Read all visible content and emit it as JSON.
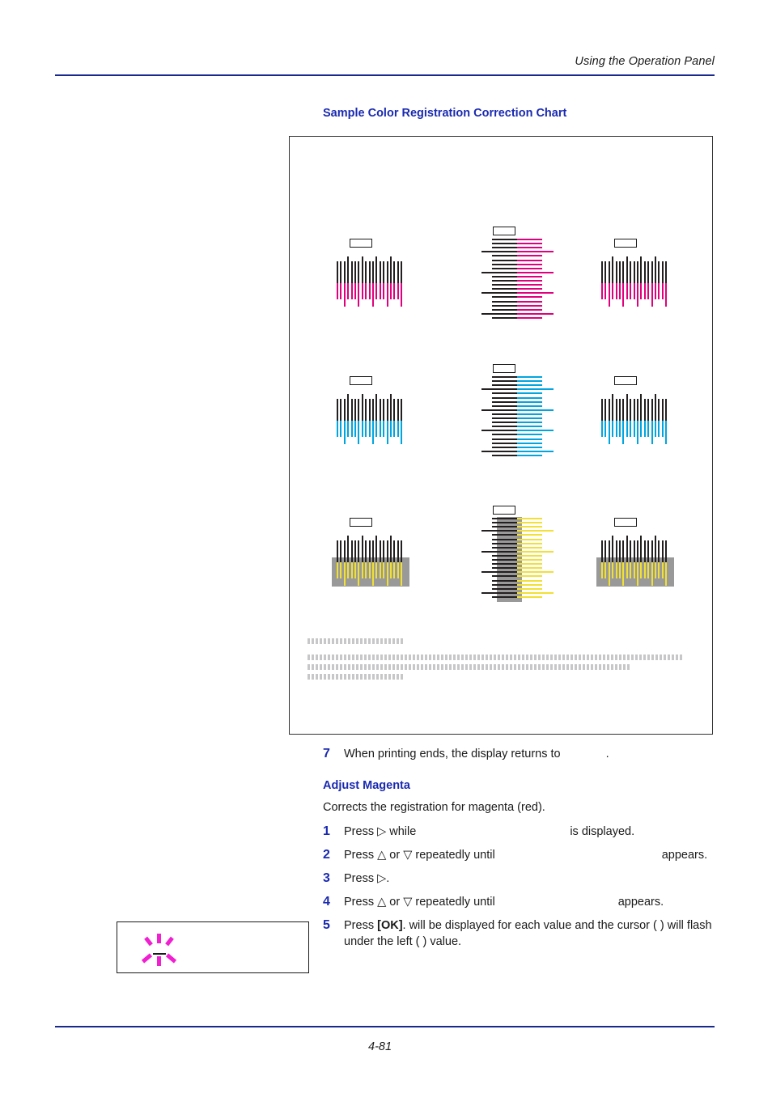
{
  "header": {
    "running_title": "Using the Operation Panel"
  },
  "section": {
    "heading": "Sample Color Registration Correction Chart"
  },
  "chart": {
    "rows": [
      {
        "name": "magenta",
        "color": "#e0007d",
        "label": "Magenta registration patterns",
        "cells": [
          "left-vertical-comb",
          "center-horizontal-ladder",
          "right-vertical-comb"
        ]
      },
      {
        "name": "cyan",
        "color": "#00a5e0",
        "label": "Cyan registration patterns",
        "cells": [
          "left-vertical-comb",
          "center-horizontal-ladder",
          "right-vertical-comb"
        ]
      },
      {
        "name": "yellow",
        "color": "#f2e033",
        "label": "Yellow registration patterns",
        "backdrop": "#999999",
        "cells": [
          "left-vertical-comb",
          "center-horizontal-ladder",
          "right-vertical-comb"
        ]
      }
    ],
    "obscured_text_lines": 4
  },
  "steps": [
    {
      "number": "7",
      "text_before": "When printing ends, the display returns to",
      "text_after": "."
    },
    {
      "number": "1",
      "text_before": "Press ▷ while",
      "text_after": "is displayed."
    },
    {
      "number": "2",
      "text_before": "Press △ or ▽ repeatedly until",
      "text_after": "appears."
    },
    {
      "number": "3",
      "text_before": "Press ▷.",
      "text_after": ""
    },
    {
      "number": "4",
      "text_before": "Press △ or ▽ repeatedly until",
      "text_after": "appears."
    },
    {
      "number": "5",
      "text_before": "Press",
      "ok_key": "[OK]",
      "text_after": ".    will be displayed for each value and the cursor (  ) will flash under the left (  ) value."
    }
  ],
  "adjust_magenta": {
    "heading": "Adjust Magenta",
    "description": "Corrects the registration for magenta (red)."
  },
  "note_box": {
    "icon": "blinking-cursor-icon",
    "icon_color": "#f020d0"
  },
  "footer": {
    "page_number": "4-81"
  }
}
